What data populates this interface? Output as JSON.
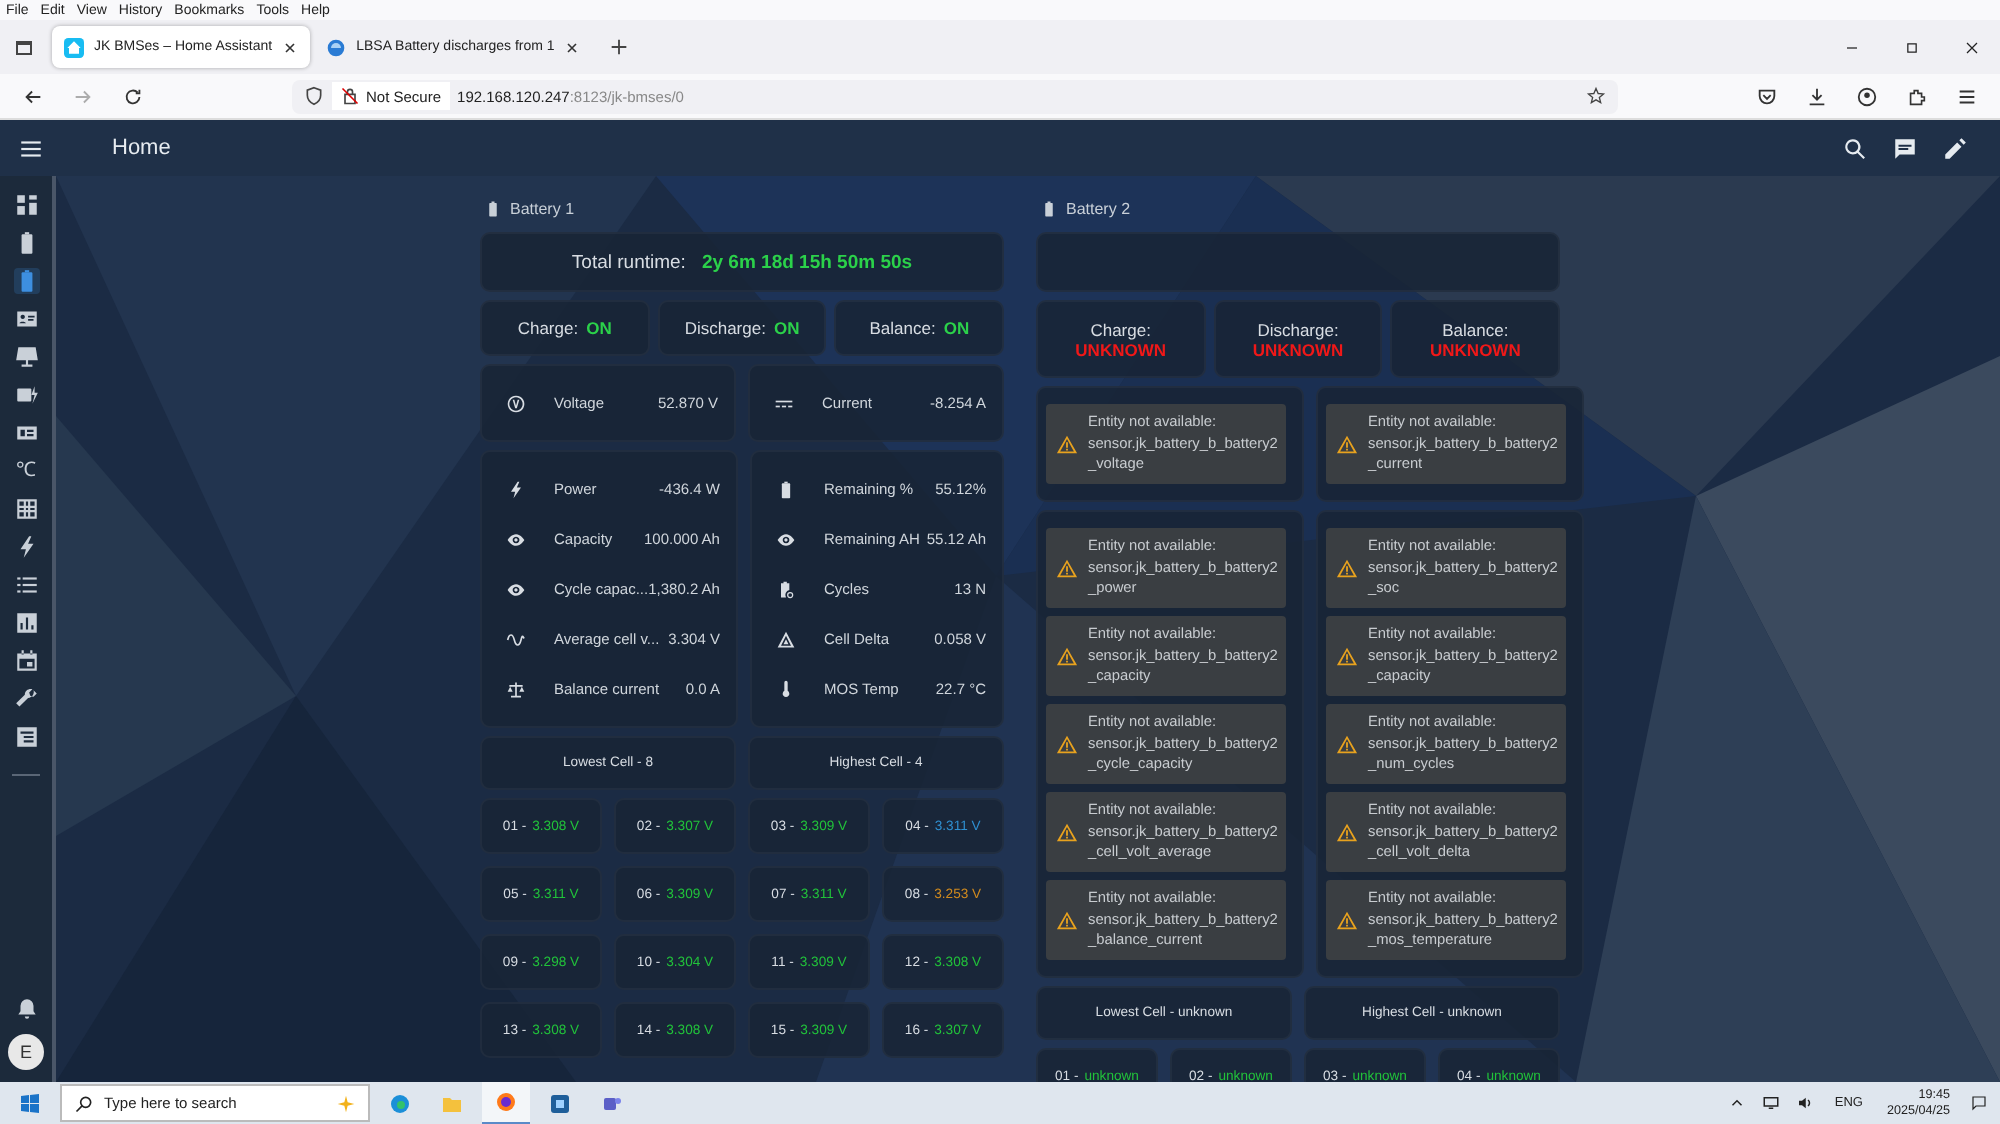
{
  "browser": {
    "menu": [
      "File",
      "Edit",
      "View",
      "History",
      "Bookmarks",
      "Tools",
      "Help"
    ],
    "tabs": [
      {
        "title": "JK BMSes – Home Assistant",
        "selected": true
      },
      {
        "title": "LBSA Battery discharges from 1",
        "selected": false
      }
    ],
    "address": {
      "security": "Not Secure",
      "host": "192.168.120.247",
      "path": ":8123/jk-bmses/0"
    }
  },
  "header": {
    "title": "Home"
  },
  "sidebar": {
    "items": [
      {
        "selected": false
      },
      {
        "selected": false
      },
      {
        "selected": true
      },
      {
        "selected": false
      },
      {
        "selected": false
      },
      {
        "selected": false
      },
      {
        "selected": false
      },
      {
        "glyph": "℃",
        "selected": false
      },
      {
        "selected": false
      },
      {
        "selected": false
      },
      {
        "selected": false
      },
      {
        "selected": false
      },
      {
        "selected": false
      },
      {
        "selected": false
      },
      {
        "selected": false
      }
    ],
    "user": "E"
  },
  "batteries": [
    {
      "title": "Battery 1",
      "runtime": {
        "label": "Total runtime:",
        "value": "2y 6m 18d 15h 50m 50s"
      },
      "switches": [
        {
          "kind": "inline",
          "label": "Charge:",
          "value": "ON",
          "color": "#2bd14a"
        },
        {
          "kind": "inline",
          "label": "Discharge:",
          "value": "ON",
          "color": "#2bd14a"
        },
        {
          "kind": "inline",
          "label": "Balance:",
          "value": "ON",
          "color": "#2bd14a"
        }
      ],
      "top": [
        [
          {
            "kind": "entity",
            "name": "Voltage",
            "value": "52.870 V"
          }
        ],
        [
          {
            "kind": "entity",
            "name": "Current",
            "value": "-8.254 A"
          }
        ]
      ],
      "main": [
        [
          {
            "kind": "entity",
            "name": "Power",
            "value": "-436.4 W"
          },
          {
            "kind": "entity",
            "name": "Capacity",
            "value": "100.000 Ah"
          },
          {
            "kind": "entity",
            "name": "Cycle capac...",
            "value": "1,380.2 Ah"
          },
          {
            "kind": "entity",
            "name": "Average cell v...",
            "value": "3.304 V"
          },
          {
            "kind": "entity",
            "name": "Balance current",
            "value": "0.0 A"
          }
        ],
        [
          {
            "kind": "entity",
            "name": "Remaining %",
            "value": "55.12%"
          },
          {
            "kind": "entity",
            "name": "Remaining AH",
            "value": "55.12 Ah"
          },
          {
            "kind": "entity",
            "name": "Cycles",
            "value": "13 N"
          },
          {
            "kind": "entity",
            "name": "Cell Delta",
            "value": "0.058 V"
          },
          {
            "kind": "entity",
            "name": "MOS Temp",
            "value": "22.7 °C"
          }
        ]
      ],
      "extremes": [
        "Lowest Cell - 8",
        "Highest Cell - 4"
      ],
      "cells": [
        {
          "label": "01 -",
          "value": "3.308 V",
          "color": "#21c23a"
        },
        {
          "label": "02 -",
          "value": "3.307 V",
          "color": "#21c23a"
        },
        {
          "label": "03 -",
          "value": "3.309 V",
          "color": "#21c23a"
        },
        {
          "label": "04 -",
          "value": "3.311 V",
          "color": "#2f8fd0"
        },
        {
          "label": "05 -",
          "value": "3.311 V",
          "color": "#21c23a"
        },
        {
          "label": "06 -",
          "value": "3.309 V",
          "color": "#21c23a"
        },
        {
          "label": "07 -",
          "value": "3.311 V",
          "color": "#21c23a"
        },
        {
          "label": "08 -",
          "value": "3.253 V",
          "color": "#d08a1e"
        },
        {
          "label": "09 -",
          "value": "3.298 V",
          "color": "#21c23a"
        },
        {
          "label": "10 -",
          "value": "3.304 V",
          "color": "#21c23a"
        },
        {
          "label": "11 -",
          "value": "3.309 V",
          "color": "#21c23a"
        },
        {
          "label": "12 -",
          "value": "3.308 V",
          "color": "#21c23a"
        },
        {
          "label": "13 -",
          "value": "3.308 V",
          "color": "#21c23a"
        },
        {
          "label": "14 -",
          "value": "3.308 V",
          "color": "#21c23a"
        },
        {
          "label": "15 -",
          "value": "3.309 V",
          "color": "#21c23a"
        },
        {
          "label": "16 -",
          "value": "3.307 V",
          "color": "#21c23a"
        }
      ]
    },
    {
      "title": "Battery 2",
      "switches": [
        {
          "kind": "stacked",
          "label": "Charge:",
          "value": "UNKNOWN",
          "color": "#f01818"
        },
        {
          "kind": "stacked",
          "label": "Discharge:",
          "value": "UNKNOWN",
          "color": "#f01818"
        },
        {
          "kind": "stacked",
          "label": "Balance:",
          "value": "UNKNOWN",
          "color": "#f01818"
        }
      ],
      "top": [
        [
          {
            "kind": "warning",
            "label": "Entity not available:",
            "entity": "sensor.jk_battery_b_battery2_voltage"
          }
        ],
        [
          {
            "kind": "warning",
            "label": "Entity not available:",
            "entity": "sensor.jk_battery_b_battery2_current"
          }
        ]
      ],
      "main": [
        [
          {
            "kind": "warning",
            "label": "Entity not available:",
            "entity": "sensor.jk_battery_b_battery2_power"
          },
          {
            "kind": "warning",
            "label": "Entity not available:",
            "entity": "sensor.jk_battery_b_battery2_capacity"
          },
          {
            "kind": "warning",
            "label": "Entity not available:",
            "entity": "sensor.jk_battery_b_battery2_cycle_capacity"
          },
          {
            "kind": "warning",
            "label": "Entity not available:",
            "entity": "sensor.jk_battery_b_battery2_cell_volt_average"
          },
          {
            "kind": "warning",
            "label": "Entity not available:",
            "entity": "sensor.jk_battery_b_battery2_balance_current"
          }
        ],
        [
          {
            "kind": "warning",
            "label": "Entity not available:",
            "entity": "sensor.jk_battery_b_battery2_soc"
          },
          {
            "kind": "warning",
            "label": "Entity not available:",
            "entity": "sensor.jk_battery_b_battery2_capacity"
          },
          {
            "kind": "warning",
            "label": "Entity not available:",
            "entity": "sensor.jk_battery_b_battery2_num_cycles"
          },
          {
            "kind": "warning",
            "label": "Entity not available:",
            "entity": "sensor.jk_battery_b_battery2_cell_volt_delta"
          },
          {
            "kind": "warning",
            "label": "Entity not available:",
            "entity": "sensor.jk_battery_b_battery2_mos_temperature"
          }
        ]
      ],
      "extremes": [
        "Lowest Cell - unknown",
        "Highest Cell - unknown"
      ],
      "cells": [
        {
          "label": "01 -",
          "value": "unknown",
          "color": "#21c23a"
        },
        {
          "label": "02 -",
          "value": "unknown",
          "color": "#21c23a"
        },
        {
          "label": "03 -",
          "value": "unknown",
          "color": "#21c23a"
        },
        {
          "label": "04 -",
          "value": "unknown",
          "color": "#21c23a"
        }
      ]
    }
  ],
  "taskbar": {
    "search_placeholder": "Type here to search",
    "language": "ENG",
    "time": "19:45",
    "date": "2025/04/25"
  }
}
